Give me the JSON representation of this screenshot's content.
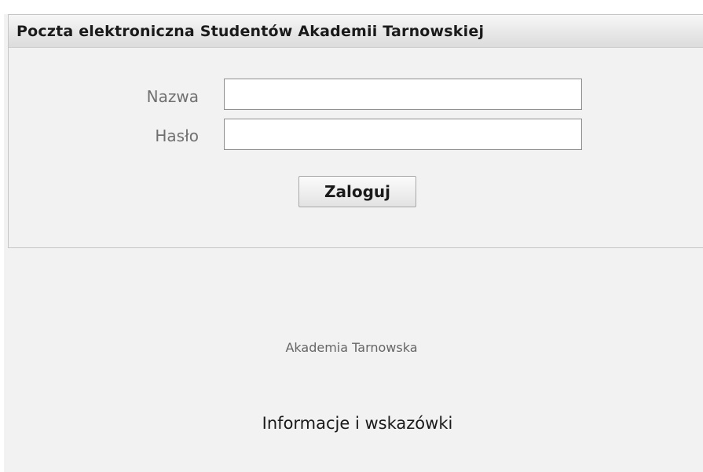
{
  "panel": {
    "title": "Poczta elektroniczna Studentów Akademii Tarnowskiej"
  },
  "form": {
    "username_label": "Nazwa",
    "username_value": "",
    "password_label": "Hasło",
    "password_value": "",
    "submit_label": "Zaloguj"
  },
  "footer": {
    "organization": "Akademia Tarnowska",
    "info_link": "Informacje i wskazówki"
  },
  "colors": {
    "background": "#f2f2f2",
    "header_gradient_top": "#f7f7f7",
    "header_gradient_bottom": "#dcdcdc",
    "label_text": "#707070",
    "title_text": "#1a1a1a"
  }
}
